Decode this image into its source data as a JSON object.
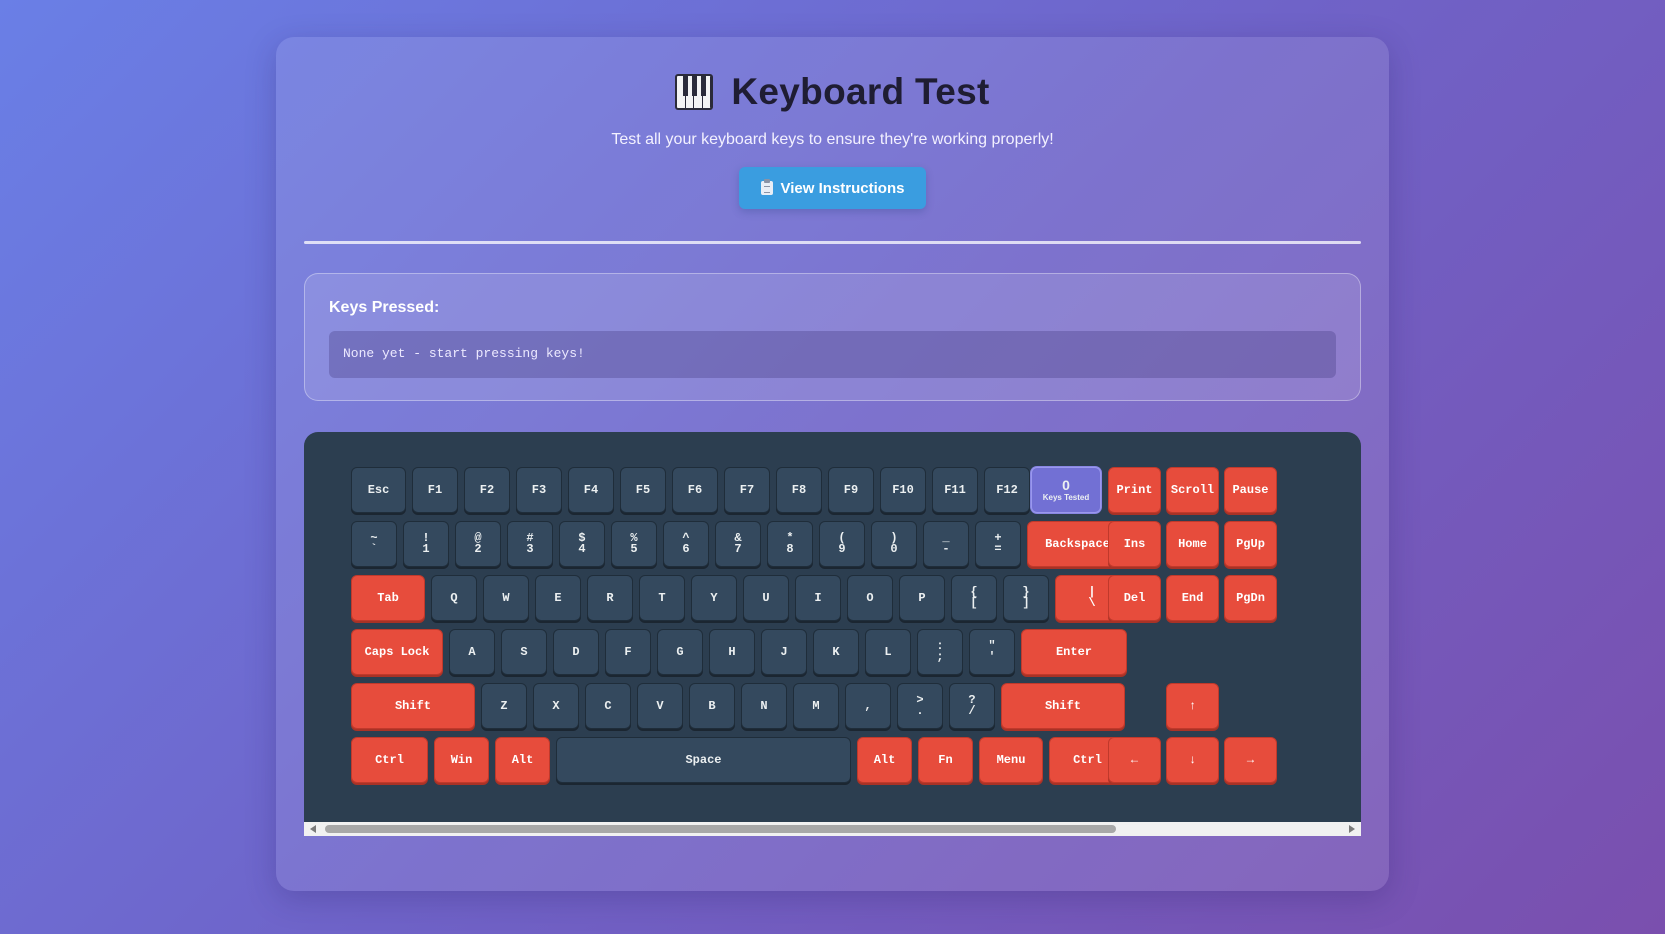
{
  "header": {
    "title": "Keyboard Test",
    "icon": "piano-keys-icon",
    "subtitle": "Test all your keyboard keys to ensure they're working properly!",
    "instructions_button": "View Instructions",
    "instructions_icon": "clipboard-icon"
  },
  "pressed": {
    "label": "Keys Pressed:",
    "value": "None yet - start pressing keys!"
  },
  "stats": {
    "count": "0",
    "label": "Keys Tested"
  },
  "keyboard": {
    "rows": [
      [
        [
          "Esc"
        ],
        [
          "F1"
        ],
        [
          "F2"
        ],
        [
          "F3"
        ],
        [
          "F4"
        ],
        [
          "F5"
        ],
        [
          "F6"
        ],
        [
          "F7"
        ],
        [
          "F8"
        ],
        [
          "F9"
        ],
        [
          "F10"
        ],
        [
          "F11"
        ],
        [
          "F12"
        ]
      ],
      [
        [
          "~",
          "`"
        ],
        [
          "!",
          "1"
        ],
        [
          "@",
          "2"
        ],
        [
          "#",
          "3"
        ],
        [
          "$",
          "4"
        ],
        [
          "%",
          "5"
        ],
        [
          "^",
          "6"
        ],
        [
          "&",
          "7"
        ],
        [
          "*",
          "8"
        ],
        [
          "(",
          "9"
        ],
        [
          ")",
          "0"
        ],
        [
          "_",
          "-"
        ],
        [
          "+",
          "="
        ],
        [
          "Backspace"
        ]
      ],
      [
        [
          "Tab"
        ],
        [
          "Q"
        ],
        [
          "W"
        ],
        [
          "E"
        ],
        [
          "R"
        ],
        [
          "T"
        ],
        [
          "Y"
        ],
        [
          "U"
        ],
        [
          "I"
        ],
        [
          "O"
        ],
        [
          "P"
        ],
        [
          "{",
          "["
        ],
        [
          "}",
          "]"
        ],
        [
          "|",
          "\\"
        ]
      ],
      [
        [
          "Caps Lock"
        ],
        [
          "A"
        ],
        [
          "S"
        ],
        [
          "D"
        ],
        [
          "F"
        ],
        [
          "G"
        ],
        [
          "H"
        ],
        [
          "J"
        ],
        [
          "K"
        ],
        [
          "L"
        ],
        [
          ":",
          ";"
        ],
        [
          "\"",
          "'"
        ],
        [
          "Enter"
        ]
      ],
      [
        [
          "Shift"
        ],
        [
          "Z"
        ],
        [
          "X"
        ],
        [
          "C"
        ],
        [
          "V"
        ],
        [
          "B"
        ],
        [
          "N"
        ],
        [
          "M"
        ],
        [
          ","
        ],
        [
          ">",
          "."
        ],
        [
          "?",
          "/"
        ],
        [
          "Shift"
        ]
      ],
      [
        [
          "Ctrl"
        ],
        [
          "Win"
        ],
        [
          "Alt"
        ],
        [
          "Space"
        ],
        [
          "Alt"
        ],
        [
          "Fn"
        ],
        [
          "Menu"
        ],
        [
          "Ctrl"
        ]
      ]
    ],
    "nav": [
      [
        "Print",
        "Scroll",
        "Pause"
      ],
      [
        "Ins",
        "Home",
        "PgUp"
      ],
      [
        "Del",
        "End",
        "PgDn"
      ]
    ],
    "arrows": {
      "up": "↑",
      "left": "←",
      "down": "↓",
      "right": "→"
    }
  },
  "colors": {
    "key": "#34495e",
    "special_key": "#e74c3c",
    "panel": "#2c3e50",
    "button": "#3a9de0"
  }
}
